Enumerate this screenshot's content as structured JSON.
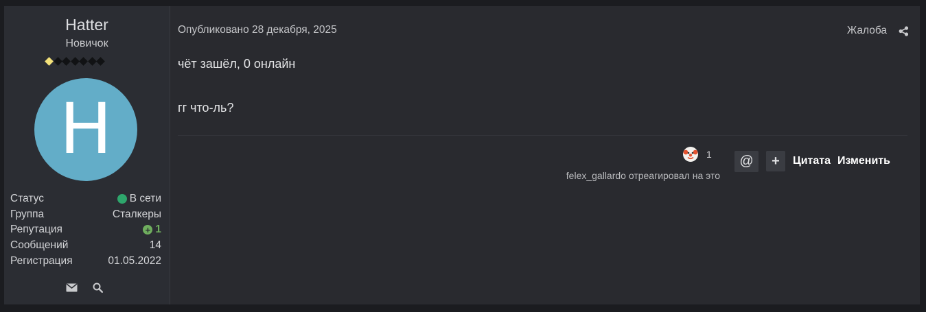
{
  "author": {
    "name": "Hatter",
    "rank": "Новичок",
    "rank_level": 1,
    "rank_max": 7,
    "avatar_letter": "H",
    "avatar_color": "#63adc8",
    "stats": {
      "status_label": "Статус",
      "status_value": "В сети",
      "group_label": "Группа",
      "group_value": "Сталкеры",
      "reputation_label": "Репутация",
      "reputation_value": "1",
      "posts_label": "Сообщений",
      "posts_value": "14",
      "registered_label": "Регистрация",
      "registered_value": "01.05.2022"
    },
    "actions": [
      "envelope-icon",
      "search-icon"
    ]
  },
  "post": {
    "date": "Опубликовано 28 декабря, 2025",
    "report_label": "Жалоба",
    "lines": [
      "чёт зашёл, 0 онлайн",
      "гг что-ль?"
    ],
    "reaction": {
      "icon": "clown-face-icon",
      "count": "1",
      "reacted_by": "felex_gallardo отреагировал на это"
    },
    "mention_label": "@",
    "multiquote_label": "+",
    "quote_label": "Цитата",
    "edit_label": "Изменить"
  },
  "colors": {
    "online": "#2ea66c",
    "reputation": "#6fae5e",
    "rank_pip_active": "#f4e27a"
  }
}
